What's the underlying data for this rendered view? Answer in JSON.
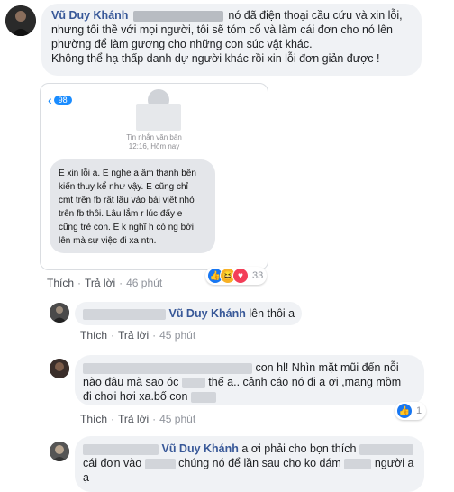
{
  "comment1": {
    "author": "Vũ Duy Khánh",
    "line1_end": "nó đã điện thoại cầu cứu và xin lỗi,",
    "line2": "nhưng tôi thề với mọi người, tôi sẽ tóm cổ và làm cái đơn cho nó lên",
    "line3": "phường để làm gương cho những con súc vật khác.",
    "line4": "Không thể hạ thấp danh dự người khác rồi xin lỗi đơn giản được !",
    "sms": {
      "back_count": "98",
      "header_title": "Tin nhắn văn bản",
      "header_time": "12:16, Hôm nay",
      "lines": [
        "E xin lỗi a. E nghe a âm thanh bên",
        "kiến thuy kể như vậy. E cũng chỉ",
        "cmt trên fb rất lâu vào bài viết nhỏ",
        "trên fb thôi. Lâu lắm r lúc đấy e",
        "cũng trẻ con. E k nghĩ h có ng bới",
        "lên mà sự việc đi xa ntn."
      ]
    },
    "actions": {
      "like": "Thích",
      "reply": "Trả lời",
      "time": "46 phút"
    },
    "reaction_count": "33"
  },
  "reply1": {
    "author": "Vũ Duy Khánh",
    "text": "lên thôi a",
    "actions": {
      "like": "Thích",
      "reply": "Trả lời",
      "time": "45 phút"
    }
  },
  "reply2": {
    "line1_end": "con hl! Nhìn mặt mũi đến nỗi",
    "line2_a": "nào đâu mà sao óc",
    "line2_b": "thế a.. cảnh cáo nó đi a ơi ,mang mồm",
    "line3": "đi chơi hơi xa.bố con",
    "actions": {
      "like": "Thích",
      "reply": "Trả lời",
      "time": "45 phút"
    },
    "like_count": "1"
  },
  "reply3": {
    "author": "Vũ Duy Khánh",
    "line1": "a ơi phải cho bọn thích",
    "line2_a": "cái đơn vào",
    "line2_b": "chúng nó để lần sau cho ko dám",
    "line2_c": "người a",
    "line3": "ạ"
  },
  "colors": {
    "name": "#385898",
    "bubble": "#f0f2f5",
    "like_blue": "#1877f2",
    "love_red": "#f33e58",
    "haha_yellow": "#f7b125",
    "ios_blue": "#1a8cff"
  }
}
